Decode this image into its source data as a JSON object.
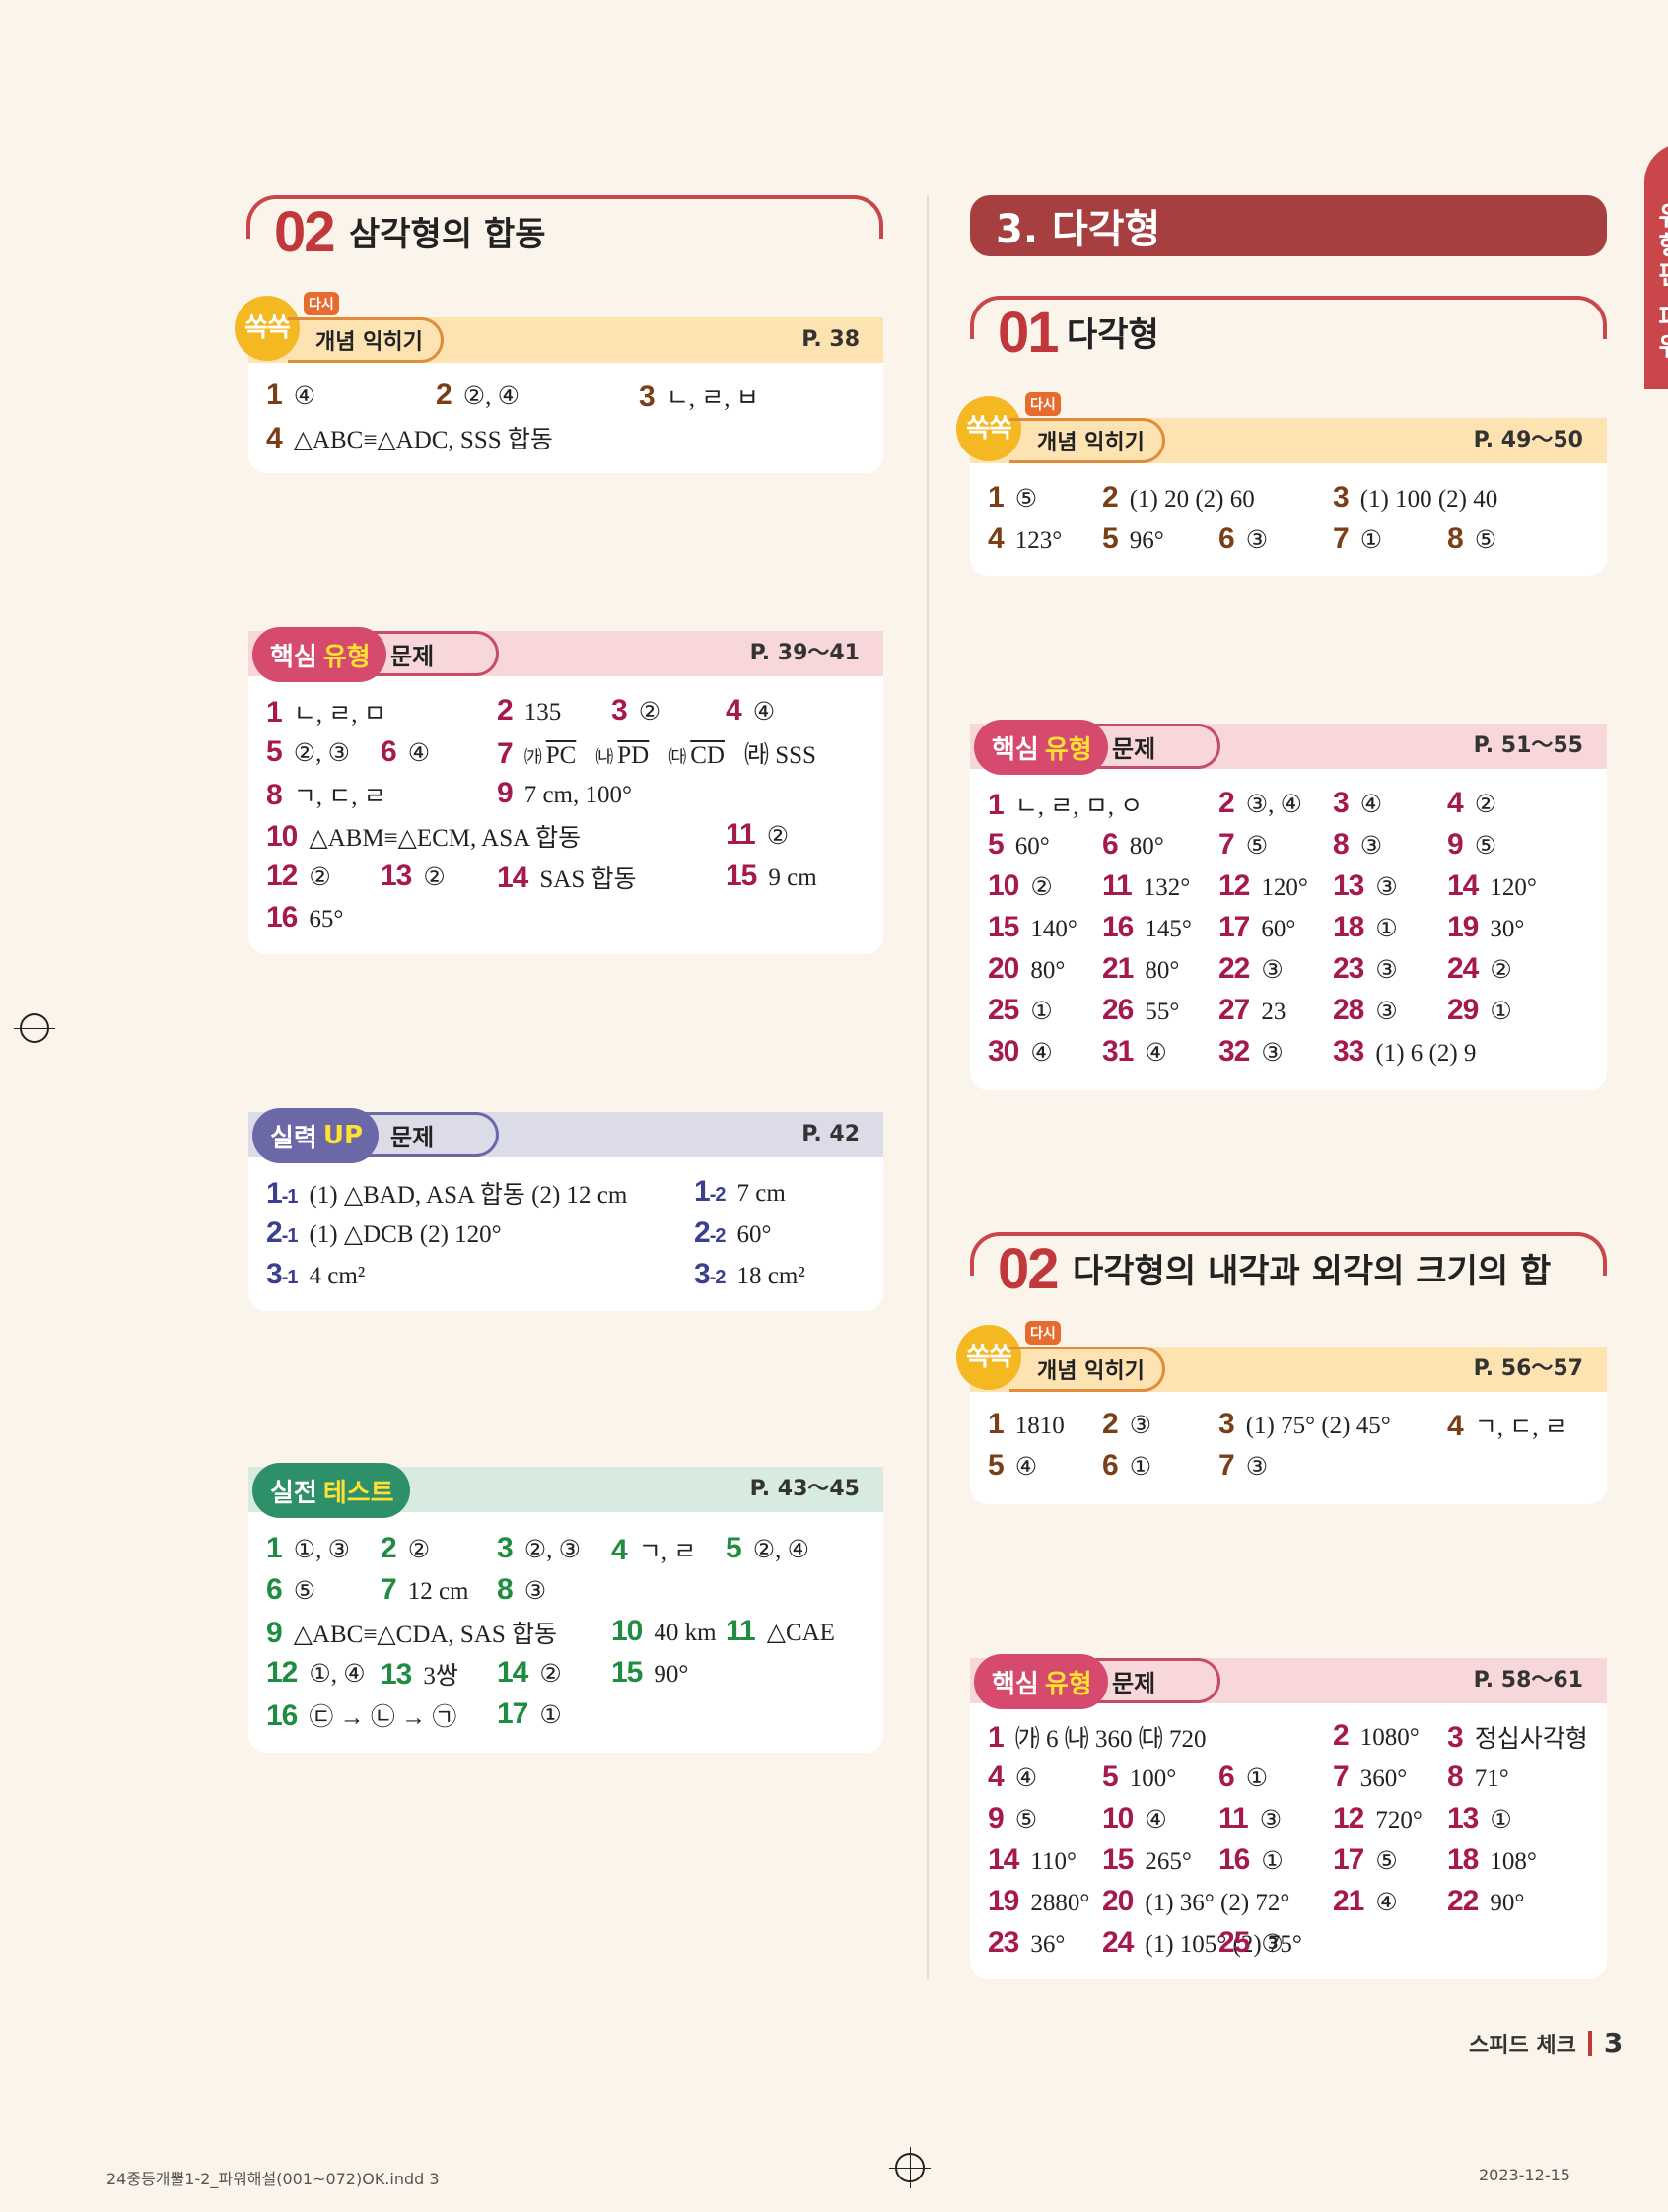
{
  "left": {
    "section": {
      "num": "02",
      "title": "삼각형의 합동"
    },
    "concept": {
      "badge": "다시",
      "ssok": "쏙쏙",
      "label": "개념 익히기",
      "page": "P. 38"
    },
    "concept_answers": [
      {
        "n": "1",
        "v": "④"
      },
      {
        "n": "2",
        "v": "②, ④"
      },
      {
        "n": "3",
        "v": "ㄴ, ㄹ, ㅂ"
      },
      {
        "n": "4",
        "v": "△ABC≡△ADC, SSS 합동"
      }
    ],
    "core": {
      "pill_a": "핵심",
      "pill_b": "유형",
      "tail": "문제",
      "page": "P. 39～41"
    },
    "core_answers": [
      {
        "n": "1",
        "v": "ㄴ, ㄹ, ㅁ"
      },
      {
        "n": "2",
        "v": "135"
      },
      {
        "n": "3",
        "v": "②"
      },
      {
        "n": "4",
        "v": "④"
      },
      {
        "n": "5",
        "v": "②, ③"
      },
      {
        "n": "6",
        "v": "④"
      },
      {
        "n": "7",
        "v1": "㈎",
        "v2": "PC",
        "v3": "㈏",
        "v4": "PD",
        "v5": "㈐",
        "v6": "CD",
        "v7": "㈑ SSS"
      },
      {
        "n": "8",
        "v": "ㄱ, ㄷ, ㄹ"
      },
      {
        "n": "9",
        "v": "7 cm, 100°"
      },
      {
        "n": "10",
        "v": "△ABM≡△ECM, ASA 합동"
      },
      {
        "n": "11",
        "v": "②"
      },
      {
        "n": "12",
        "v": "②"
      },
      {
        "n": "13",
        "v": "②"
      },
      {
        "n": "14",
        "v": "SAS 합동"
      },
      {
        "n": "15",
        "v": "9 cm"
      },
      {
        "n": "16",
        "v": "65°"
      }
    ],
    "up": {
      "pill_a": "실력",
      "pill_b": "UP",
      "tail": "문제",
      "page": "P. 42"
    },
    "up_answers": [
      {
        "n": "1",
        "s": "-1",
        "v": "(1) △BAD, ASA 합동   (2) 12 cm"
      },
      {
        "n": "1",
        "s": "-2",
        "v": "7 cm"
      },
      {
        "n": "2",
        "s": "-1",
        "v": "(1) △DCB   (2) 120°"
      },
      {
        "n": "2",
        "s": "-2",
        "v": "60°"
      },
      {
        "n": "3",
        "s": "-1",
        "v": "4 cm²"
      },
      {
        "n": "3",
        "s": "-2",
        "v": "18 cm²"
      }
    ],
    "test": {
      "pill_a": "실전",
      "pill_b": "테스트",
      "page": "P. 43～45"
    },
    "test_answers": [
      {
        "n": "1",
        "v": "①, ③"
      },
      {
        "n": "2",
        "v": "②"
      },
      {
        "n": "3",
        "v": "②, ③"
      },
      {
        "n": "4",
        "v": "ㄱ, ㄹ"
      },
      {
        "n": "5",
        "v": "②, ④"
      },
      {
        "n": "6",
        "v": "⑤"
      },
      {
        "n": "7",
        "v": "12 cm"
      },
      {
        "n": "8",
        "v": "③"
      },
      {
        "n": "9",
        "v": "△ABC≡△CDA, SAS 합동"
      },
      {
        "n": "10",
        "v": "40 km"
      },
      {
        "n": "11",
        "v": "△CAE"
      },
      {
        "n": "12",
        "v": "①, ④"
      },
      {
        "n": "13",
        "v": "3쌍"
      },
      {
        "n": "14",
        "v": "②"
      },
      {
        "n": "15",
        "v": "90°"
      },
      {
        "n": "16",
        "v": "㉢ → ㉡ → ㉠"
      },
      {
        "n": "17",
        "v": "①"
      }
    ]
  },
  "right": {
    "chapter": "3. 다각형",
    "sec1": {
      "num": "01",
      "title": "다각형"
    },
    "concept1": {
      "badge": "다시",
      "ssok": "쏙쏙",
      "label": "개념 익히기",
      "page": "P. 49～50"
    },
    "concept1_answers": [
      {
        "n": "1",
        "v": "⑤"
      },
      {
        "n": "2",
        "v": "(1) 20   (2) 60"
      },
      {
        "n": "3",
        "v": "(1) 100   (2) 40"
      },
      {
        "n": "4",
        "v": "123°"
      },
      {
        "n": "5",
        "v": "96°"
      },
      {
        "n": "6",
        "v": "③"
      },
      {
        "n": "7",
        "v": "①"
      },
      {
        "n": "8",
        "v": "⑤"
      }
    ],
    "core1": {
      "pill_a": "핵심",
      "pill_b": "유형",
      "tail": "문제",
      "page": "P. 51～55"
    },
    "core1_answers": [
      {
        "n": "1",
        "v": "ㄴ, ㄹ, ㅁ, ㅇ"
      },
      {
        "n": "2",
        "v": "③, ④"
      },
      {
        "n": "3",
        "v": "④"
      },
      {
        "n": "4",
        "v": "②"
      },
      {
        "n": "5",
        "v": "60°"
      },
      {
        "n": "6",
        "v": "80°"
      },
      {
        "n": "7",
        "v": "⑤"
      },
      {
        "n": "8",
        "v": "③"
      },
      {
        "n": "9",
        "v": "⑤"
      },
      {
        "n": "10",
        "v": "②"
      },
      {
        "n": "11",
        "v": "132°"
      },
      {
        "n": "12",
        "v": "120°"
      },
      {
        "n": "13",
        "v": "③"
      },
      {
        "n": "14",
        "v": "120°"
      },
      {
        "n": "15",
        "v": "140°"
      },
      {
        "n": "16",
        "v": "145°"
      },
      {
        "n": "17",
        "v": "60°"
      },
      {
        "n": "18",
        "v": "①"
      },
      {
        "n": "19",
        "v": "30°"
      },
      {
        "n": "20",
        "v": "80°"
      },
      {
        "n": "21",
        "v": "80°"
      },
      {
        "n": "22",
        "v": "③"
      },
      {
        "n": "23",
        "v": "③"
      },
      {
        "n": "24",
        "v": "②"
      },
      {
        "n": "25",
        "v": "①"
      },
      {
        "n": "26",
        "v": "55°"
      },
      {
        "n": "27",
        "v": "23"
      },
      {
        "n": "28",
        "v": "③"
      },
      {
        "n": "29",
        "v": "①"
      },
      {
        "n": "30",
        "v": "④"
      },
      {
        "n": "31",
        "v": "④"
      },
      {
        "n": "32",
        "v": "③"
      },
      {
        "n": "33",
        "v": "(1) 6   (2) 9"
      }
    ],
    "sec2": {
      "num": "02",
      "title": "다각형의 내각과 외각의 크기의 합"
    },
    "concept2": {
      "badge": "다시",
      "ssok": "쏙쏙",
      "label": "개념 익히기",
      "page": "P. 56～57"
    },
    "concept2_answers": [
      {
        "n": "1",
        "v": "1810"
      },
      {
        "n": "2",
        "v": "③"
      },
      {
        "n": "3",
        "v": "(1) 75°   (2) 45°"
      },
      {
        "n": "4",
        "v": "ㄱ, ㄷ, ㄹ"
      },
      {
        "n": "5",
        "v": "④"
      },
      {
        "n": "6",
        "v": "①"
      },
      {
        "n": "7",
        "v": "③"
      }
    ],
    "core2": {
      "pill_a": "핵심",
      "pill_b": "유형",
      "tail": "문제",
      "page": "P. 58～61"
    },
    "core2_answers": [
      {
        "n": "1",
        "v": "㈎ 6   ㈏ 360   ㈐ 720"
      },
      {
        "n": "2",
        "v": "1080°"
      },
      {
        "n": "3",
        "v": "정십사각형"
      },
      {
        "n": "4",
        "v": "④"
      },
      {
        "n": "5",
        "v": "100°"
      },
      {
        "n": "6",
        "v": "①"
      },
      {
        "n": "7",
        "v": "360°"
      },
      {
        "n": "8",
        "v": "71°"
      },
      {
        "n": "9",
        "v": "⑤"
      },
      {
        "n": "10",
        "v": "④"
      },
      {
        "n": "11",
        "v": "③"
      },
      {
        "n": "12",
        "v": "720°"
      },
      {
        "n": "13",
        "v": "①"
      },
      {
        "n": "14",
        "v": "110°"
      },
      {
        "n": "15",
        "v": "265°"
      },
      {
        "n": "16",
        "v": "①"
      },
      {
        "n": "17",
        "v": "⑤"
      },
      {
        "n": "18",
        "v": "108°"
      },
      {
        "n": "19",
        "v": "2880°"
      },
      {
        "n": "20",
        "v": "(1) 36°   (2) 72°"
      },
      {
        "n": "21",
        "v": "④"
      },
      {
        "n": "22",
        "v": "90°"
      },
      {
        "n": "23",
        "v": "36°"
      },
      {
        "n": "24",
        "v": "(1) 105°   (2) 75°"
      },
      {
        "n": "25",
        "v": "③"
      }
    ]
  },
  "side_tab": "유형편 파워",
  "footer": {
    "speed_label": "스피드 체크",
    "page_num": "3",
    "file": "24중등개뿔1-2_파워해설(001~072)OK.indd   3",
    "date": "2023-12-15"
  },
  "colors": {
    "accent": "#c0383c",
    "core": "#d54a6d",
    "up": "#6b68a8",
    "test": "#2e9068",
    "concept_band": "#fde3b2"
  }
}
